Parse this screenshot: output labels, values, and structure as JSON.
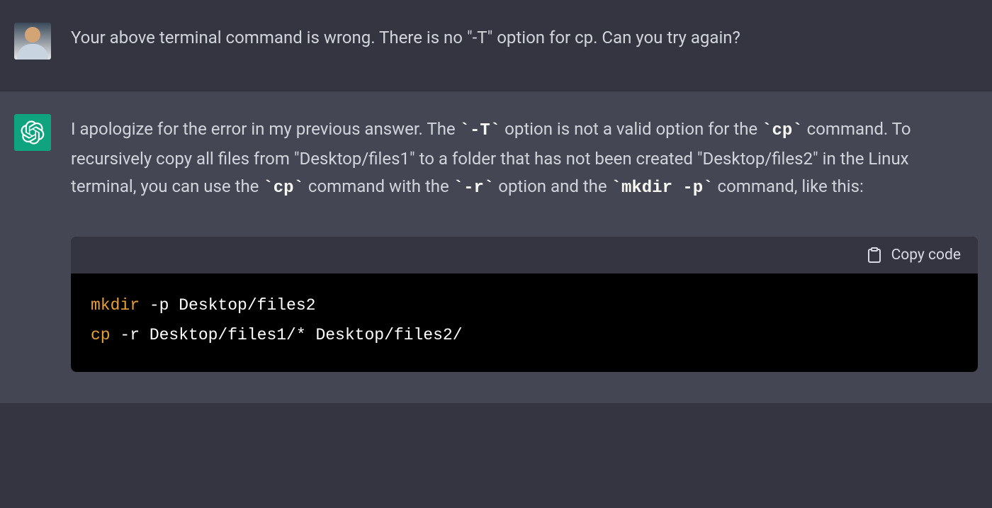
{
  "user_message": {
    "text": "Your above terminal command is wrong. There is no \"-T\" option for cp. Can you try again?"
  },
  "assistant_message": {
    "part1": "I apologize for the error in my previous answer. The ",
    "code1": "`-T`",
    "part2": " option is not a valid option for the ",
    "code2": "`cp`",
    "part3": " command. To recursively copy all files from \"Desktop/files1\" to a folder that has not been created \"Desktop/files2\" in the Linux terminal, you can use the ",
    "code3": "`cp`",
    "part4": " command with the ",
    "code4": "`-r`",
    "part5": " option and the ",
    "code5": "`mkdir -p`",
    "part6": " command, like this:"
  },
  "code_block": {
    "copy_label": "Copy code",
    "line1_cmd": "mkdir",
    "line1_args": " -p Desktop/files2",
    "line2_cmd": "cp",
    "line2_args": " -r Desktop/files1/* Desktop/files2/"
  }
}
